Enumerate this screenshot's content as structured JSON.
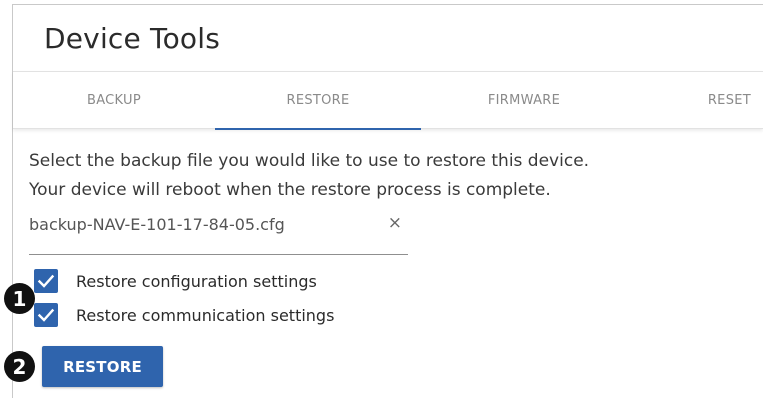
{
  "page": {
    "title": "Device Tools"
  },
  "tabs": [
    {
      "label": "BACKUP",
      "active": false
    },
    {
      "label": "RESTORE",
      "active": true
    },
    {
      "label": "FIRMWARE",
      "active": false
    },
    {
      "label": "RESET",
      "active": false
    }
  ],
  "restore": {
    "description_line1": "Select the backup file you would like to use to restore this device.",
    "description_line2": "Your device will reboot when the restore process is complete.",
    "file_name": "backup-NAV-E-101-17-84-05.cfg",
    "clear_symbol": "×",
    "options": [
      {
        "label": "Restore configuration settings",
        "checked": true
      },
      {
        "label": "Restore communication settings",
        "checked": true
      }
    ],
    "button_label": "RESTORE"
  },
  "callouts": {
    "first": "1",
    "second": "2"
  },
  "icons": {
    "checkbox_checked": "checkmark-icon",
    "file_clear": "close-icon"
  },
  "colors": {
    "accent": "#2f64ad",
    "text": "#2b2b2b",
    "muted_tab": "#8a8a8a",
    "callout": "#111111"
  }
}
